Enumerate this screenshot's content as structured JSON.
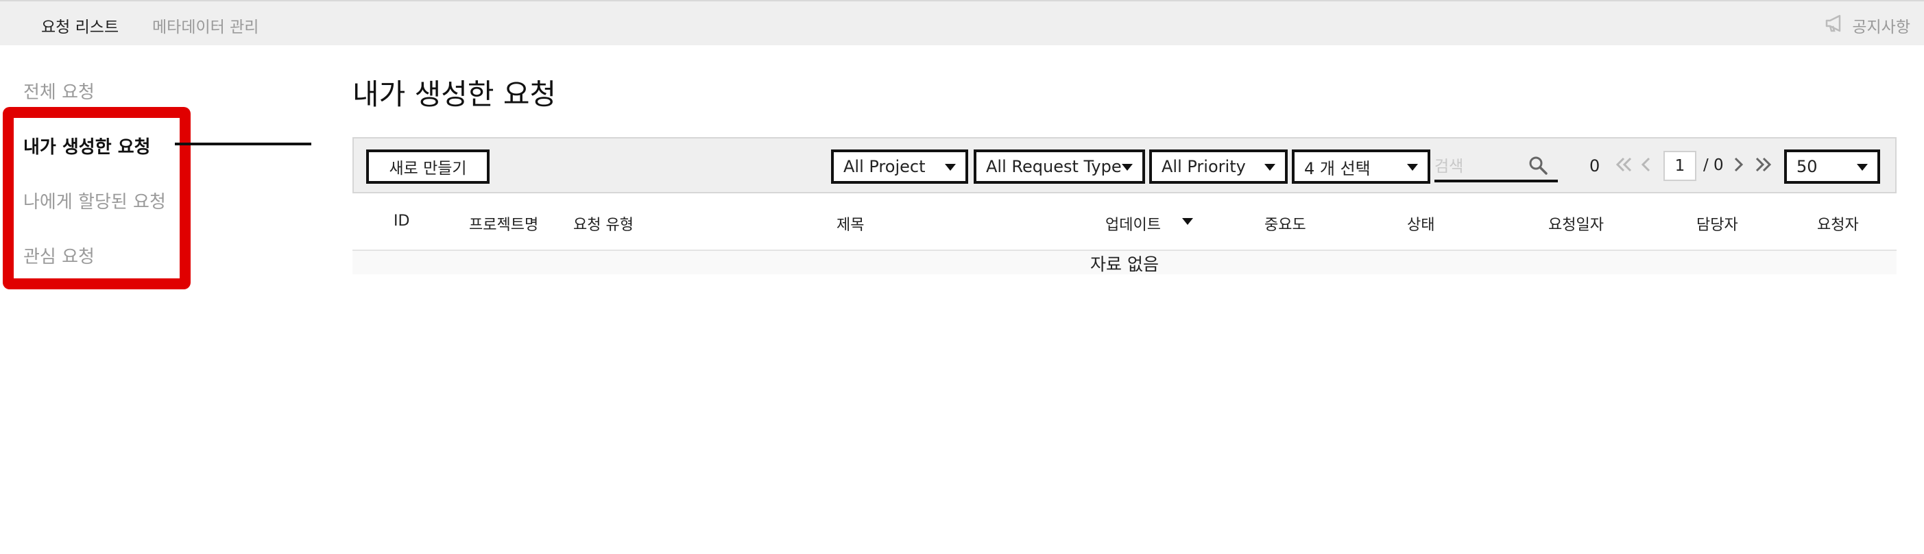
{
  "topbar": {
    "tabs": [
      {
        "label": "요청 리스트",
        "active": true
      },
      {
        "label": "메타데이터 관리",
        "active": false
      }
    ],
    "notice_label": "공지사항"
  },
  "sidebar": {
    "items": [
      {
        "label": "전체 요청",
        "active": false
      },
      {
        "label": "내가 생성한 요청",
        "active": true
      },
      {
        "label": "나에게 할당된 요청",
        "active": false
      },
      {
        "label": "관심 요청",
        "active": false
      }
    ],
    "highlight_color": "#e00000"
  },
  "main": {
    "title": "내가 생성한 요청",
    "toolbar": {
      "new_button": "새로 만들기",
      "project_select": "All Project",
      "request_type_select": "All Request Type",
      "priority_select": "All Priority",
      "status_select": "4 개 선택",
      "search_placeholder": "검색",
      "count": "0",
      "current_page": "1",
      "page_total": "/ 0",
      "page_size_select": "50"
    },
    "table": {
      "columns": [
        "ID",
        "프로젝트명",
        "요청 유형",
        "제목",
        "업데이트",
        "중요도",
        "상태",
        "요청일자",
        "담당자",
        "요청자"
      ],
      "empty_message": "자료 없음"
    }
  }
}
